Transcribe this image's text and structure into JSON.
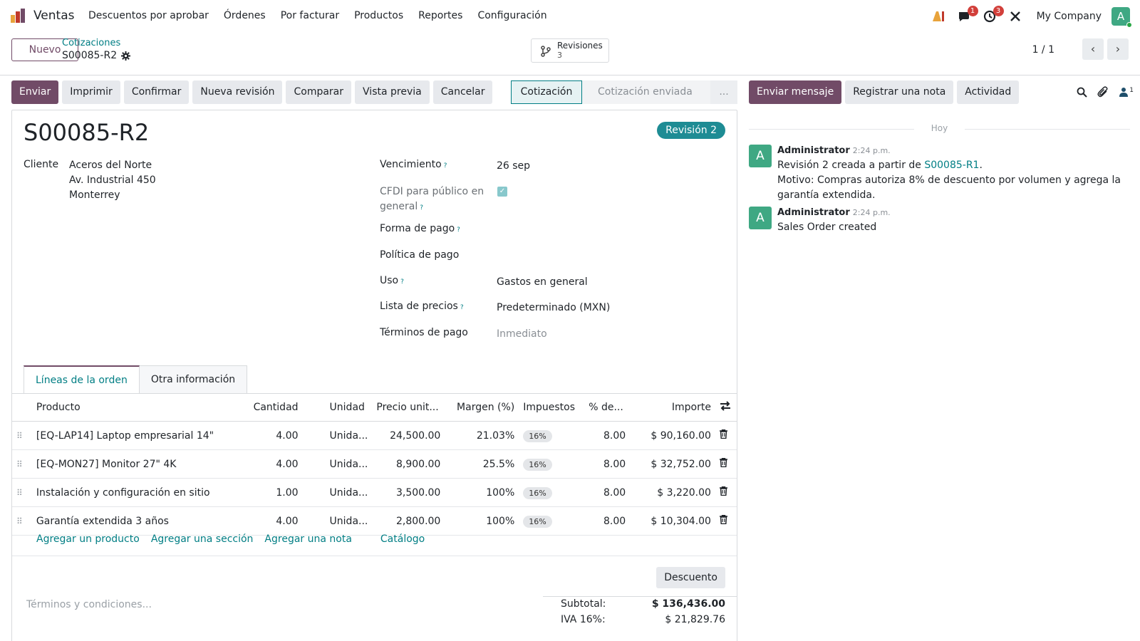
{
  "navbar": {
    "app_name": "Ventas",
    "menu": [
      "Descuentos por aprobar",
      "Órdenes",
      "Por facturar",
      "Productos",
      "Reportes",
      "Configuración"
    ],
    "messages_badge": "1",
    "activities_badge": "3",
    "company": "My Company",
    "user_initial": "A"
  },
  "control_panel": {
    "new_button": "Nuevo",
    "breadcrumb_parent": "Cotizaciones",
    "breadcrumb_current": "S00085-R2",
    "revisions_label": "Revisiones",
    "revisions_count": "3",
    "pager": "1 / 1"
  },
  "actions": [
    "Enviar",
    "Imprimir",
    "Confirmar",
    "Nueva revisión",
    "Comparar",
    "Vista previa",
    "Cancelar"
  ],
  "status": {
    "current": "Cotización",
    "next": "Cotización enviada",
    "more": "..."
  },
  "form": {
    "title": "S00085-R2",
    "revision_badge": "Revisión 2",
    "customer_label": "Cliente",
    "customer_lines": [
      "Aceros del Norte",
      "Av. Industrial 450",
      "Monterrey"
    ],
    "fields": [
      {
        "label": "Vencimiento",
        "help": "?",
        "value": ""
      },
      {
        "label": "CFDI para público en",
        "label2": "general",
        "help": "?"
      },
      {
        "label": "Forma de pago",
        "help": "?",
        "value": ""
      },
      {
        "label": "Política de pago",
        "help": "",
        "value": ""
      },
      {
        "label": "Uso",
        "help": "?",
        "value": "Gastos en general"
      },
      {
        "label": "Lista de precios",
        "help": "?",
        "value": "Predeterminado (MXN)"
      },
      {
        "label": "Términos de pago",
        "help": "",
        "value": "Inmediato"
      }
    ],
    "due_date": "26 sep",
    "cfdi_checked": true
  },
  "tabs": [
    "Líneas de la orden",
    "Otra información"
  ],
  "lines": {
    "columns": [
      "Producto",
      "Cantidad",
      "Unidad",
      "Precio unit...",
      "Margen (%)",
      "Impuestos",
      "% de...",
      "Importe"
    ],
    "rows": [
      {
        "product": "[EQ-LAP14] Laptop empresarial 14\"",
        "qty": "4.00",
        "unit": "Unida...",
        "price": "24,500.00",
        "margin": "21.03%",
        "tax": "16%",
        "disc": "8.00",
        "amount": "$ 90,160.00"
      },
      {
        "product": "[EQ-MON27] Monitor 27\" 4K",
        "qty": "4.00",
        "unit": "Unida...",
        "price": "8,900.00",
        "margin": "25.5%",
        "tax": "16%",
        "disc": "8.00",
        "amount": "$ 32,752.00"
      },
      {
        "product": "Instalación y configuración en sitio",
        "qty": "1.00",
        "unit": "Unida...",
        "price": "3,500.00",
        "margin": "100%",
        "tax": "16%",
        "disc": "8.00",
        "amount": "$ 3,220.00"
      },
      {
        "product": "Garantía extendida 3 años",
        "qty": "4.00",
        "unit": "Unida...",
        "price": "2,800.00",
        "margin": "100%",
        "tax": "16%",
        "disc": "8.00",
        "amount": "$ 10,304.00"
      }
    ],
    "add_links": [
      "Agregar un producto",
      "Agregar una sección",
      "Agregar una nota",
      "Catálogo"
    ]
  },
  "footer": {
    "discount_button": "Descuento",
    "terms_placeholder": "Términos y condiciones...",
    "subtotal_label": "Subtotal:",
    "subtotal_value": "$ 136,436.00",
    "iva_label": "IVA 16%:",
    "iva_value": "$ 21,829.76"
  },
  "chatter": {
    "send_message": "Enviar mensaje",
    "log_note": "Registrar una nota",
    "activity": "Actividad",
    "followers_count": "1",
    "today": "Hoy",
    "messages": [
      {
        "initial": "A",
        "author": "Administrator",
        "time": "2:24 p.m.",
        "line1_prefix": "Revisión 2 creada a partir de ",
        "line1_link": "S00085-R1",
        "line1_suffix": ".",
        "line2": "Motivo: Compras autoriza 8% de descuento por volumen y agrega la garantía extendida."
      },
      {
        "initial": "A",
        "author": "Administrator",
        "time": "2:24 p.m.",
        "line1_prefix": "Sales Order created"
      }
    ]
  },
  "colors": {
    "brand": "#714b67",
    "accent": "#017e84",
    "avatar": "#3fa883"
  }
}
